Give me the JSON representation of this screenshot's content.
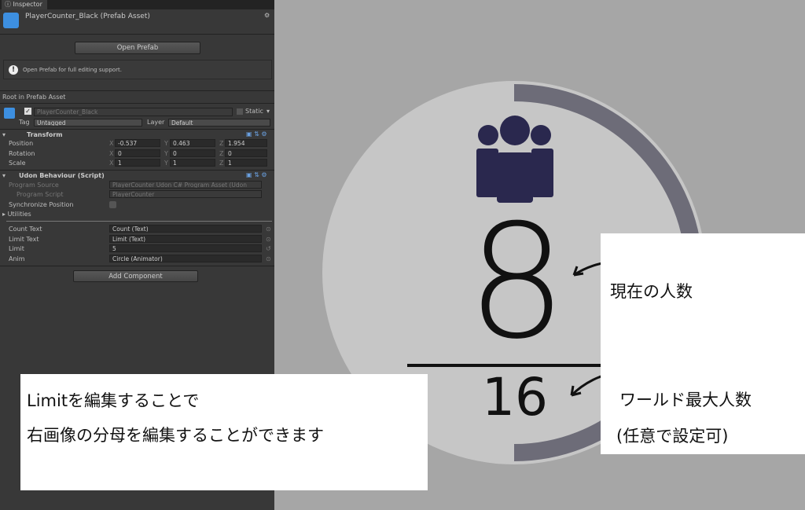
{
  "inspector": {
    "tab": "Inspector",
    "title": "PlayerCounter_Black (Prefab Asset)",
    "open_prefab": "Open Prefab",
    "info": "Open Prefab for full editing support.",
    "root_label": "Root in Prefab Asset",
    "object_name": "PlayerCounter_Black",
    "static_label": "Static",
    "tag_label": "Tag",
    "tag_value": "Untagged",
    "layer_label": "Layer",
    "layer_value": "Default",
    "transform": {
      "title": "Transform",
      "rows": [
        {
          "label": "Position",
          "x": "-0.537",
          "y": "0.463",
          "z": "1.954"
        },
        {
          "label": "Rotation",
          "x": "0",
          "y": "0",
          "z": "0"
        },
        {
          "label": "Scale",
          "x": "1",
          "y": "1",
          "z": "1"
        }
      ],
      "axis": {
        "x": "X",
        "y": "Y",
        "z": "Z"
      }
    },
    "udon": {
      "title": "Udon Behaviour (Script)",
      "program_source_label": "Program Source",
      "program_source": "PlayerCounter Udon C# Program Asset (Udon",
      "program_script_label": "Program Script",
      "program_script": "PlayerCounter",
      "sync_label": "Synchronize Position",
      "utilities": "Utilities",
      "fields": [
        {
          "label": "Count Text",
          "value": "Count (Text)"
        },
        {
          "label": "Limit Text",
          "value": "Limit (Text)"
        },
        {
          "label": "Limit",
          "value": "5"
        },
        {
          "label": "Anim",
          "value": "Circle (Animator)"
        }
      ]
    },
    "add_component": "Add Component"
  },
  "preview": {
    "count": "8",
    "limit": "16",
    "colors": {
      "circle": "#c6c6c6",
      "arc": "#6d6c78",
      "icon": "#2a284e"
    }
  },
  "annotations": {
    "current": "現在の人数",
    "world_max_1": "ワールド最大人数",
    "world_max_2": "(任意で設定可)",
    "limit_1": "Limitを編集することで",
    "limit_2": "右画像の分母を編集することができます"
  }
}
